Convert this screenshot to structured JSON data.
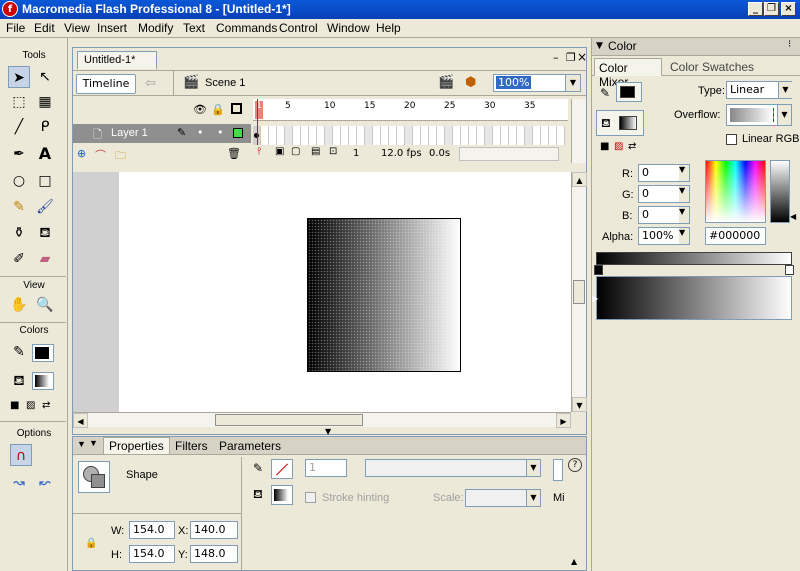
{
  "window": {
    "title": "Macromedia Flash Professional 8 - [Untitled-1*]",
    "logo_glyph": "f"
  },
  "menu": [
    "File",
    "Edit",
    "View",
    "Insert",
    "Modify",
    "Text",
    "Commands",
    "Control",
    "Window",
    "Help"
  ],
  "tools": {
    "header": "Tools",
    "view_header": "View",
    "colors_header": "Colors",
    "options_header": "Options"
  },
  "document": {
    "tab": "Untitled-1*",
    "timeline_button": "Timeline",
    "scene": "Scene 1",
    "zoom": "100%"
  },
  "timeline": {
    "layer_name": "Layer 1",
    "ruler": [
      "1",
      "5",
      "10",
      "15",
      "20",
      "25",
      "30",
      "35"
    ],
    "current_frame": "1",
    "fps": "12.0 fps",
    "time": "0.0s"
  },
  "properties": {
    "tabs": [
      "Properties",
      "Filters",
      "Parameters"
    ],
    "shape_label": "Shape",
    "w_label": "W:",
    "w_value": "154.0",
    "x_label": "X:",
    "x_value": "140.0",
    "h_label": "H:",
    "h_value": "154.0",
    "y_label": "Y:",
    "y_value": "148.0",
    "stroke_height": "1",
    "stroke_hinting": "Stroke hinting",
    "scale_label": "Scale:",
    "miter_label": "Mi"
  },
  "color_panel": {
    "title": "Color",
    "tabs": [
      "Color Mixer",
      "Color Swatches"
    ],
    "type_label": "Type:",
    "type_value": "Linear",
    "overflow_label": "Overflow:",
    "linear_rgb": "Linear RGB",
    "r_label": "R:",
    "r_value": "0",
    "g_label": "G:",
    "g_value": "0",
    "b_label": "B:",
    "b_value": "0",
    "alpha_label": "Alpha:",
    "alpha_value": "100%",
    "hex": "#000000"
  }
}
